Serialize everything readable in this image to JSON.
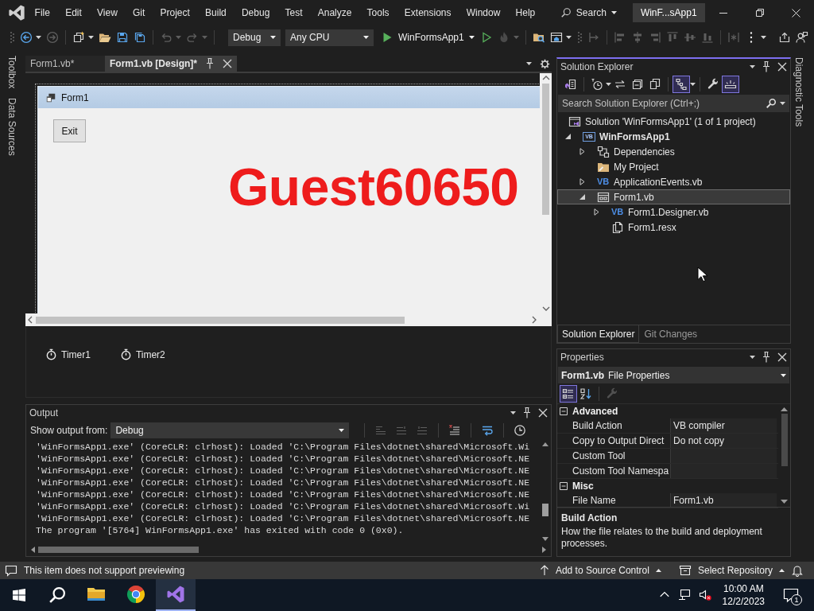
{
  "menu_bar": {
    "items": [
      "File",
      "Edit",
      "View",
      "Git",
      "Project",
      "Build",
      "Debug",
      "Test",
      "Analyze",
      "Tools",
      "Extensions",
      "Window",
      "Help"
    ],
    "search": "Search",
    "solution_name": "WinF...sApp1"
  },
  "toolbar": {
    "left_buttons": [
      {
        "kind": "back",
        "disabled": false,
        "menu": true
      },
      {
        "kind": "forward",
        "disabled": true,
        "menu": false
      },
      {
        "kind": "new-project",
        "disabled": false,
        "menu": true
      },
      {
        "kind": "open",
        "disabled": false,
        "menu": false
      },
      {
        "kind": "save",
        "disabled": false,
        "menu": false
      },
      {
        "kind": "save-all",
        "disabled": false,
        "menu": false
      },
      {
        "kind": "undo",
        "disabled": true,
        "menu": true
      },
      {
        "kind": "redo",
        "disabled": true,
        "menu": true
      }
    ],
    "configuration": "Debug",
    "platform": "Any CPU",
    "start_target": "WinFormsApp1",
    "right_buttons": [
      {
        "kind": "run-outline",
        "disabled": false,
        "menu": false
      },
      {
        "kind": "hot-reload",
        "disabled": true,
        "menu": true
      },
      {
        "kind": "folder-search",
        "disabled": false,
        "menu": false
      },
      {
        "kind": "browser",
        "disabled": false,
        "menu": true
      },
      {
        "kind": "tab-order",
        "disabled": true,
        "menu": false
      },
      {
        "kind": "align-left",
        "disabled": true,
        "menu": false
      },
      {
        "kind": "align-center",
        "disabled": true,
        "menu": false
      },
      {
        "kind": "align-right",
        "disabled": true,
        "menu": false
      },
      {
        "kind": "align-top",
        "disabled": true,
        "menu": false
      },
      {
        "kind": "align-middle",
        "disabled": true,
        "menu": false
      },
      {
        "kind": "align-bottom",
        "disabled": true,
        "menu": false
      },
      {
        "kind": "spacing",
        "disabled": true,
        "menu": false
      },
      {
        "kind": "overflow",
        "disabled": false,
        "menu": true
      }
    ],
    "end_buttons": [
      {
        "kind": "share",
        "disabled": false,
        "menu": false
      },
      {
        "kind": "feedback",
        "disabled": false,
        "menu": false
      }
    ]
  },
  "side_tabs_left": [
    "Toolbox",
    "Data Sources"
  ],
  "editor": {
    "tabs": [
      {
        "label": "Form1.vb*",
        "selected": false
      },
      {
        "label": "Form1.vb [Design]*",
        "selected": true
      }
    ],
    "form": {
      "title": "Form1",
      "button": "Exit",
      "label": "Guest60650"
    },
    "components": [
      "Timer1",
      "Timer2"
    ]
  },
  "output": {
    "title": "Output",
    "source_label": "Show output from:",
    "source": "Debug",
    "buttons": [
      {
        "kind": "goto-source",
        "disabled": true
      },
      {
        "kind": "prev-message",
        "disabled": true
      },
      {
        "kind": "next-message",
        "disabled": true
      },
      {
        "kind": "clear-all",
        "disabled": false
      },
      {
        "kind": "word-wrap",
        "disabled": false
      },
      {
        "kind": "timestamp",
        "disabled": false
      }
    ],
    "lines": [
      "'WinFormsApp1.exe' (CoreCLR: clrhost): Loaded 'C:\\Program Files\\dotnet\\shared\\Microsoft.Wi",
      "'WinFormsApp1.exe' (CoreCLR: clrhost): Loaded 'C:\\Program Files\\dotnet\\shared\\Microsoft.NE",
      "'WinFormsApp1.exe' (CoreCLR: clrhost): Loaded 'C:\\Program Files\\dotnet\\shared\\Microsoft.NE",
      "'WinFormsApp1.exe' (CoreCLR: clrhost): Loaded 'C:\\Program Files\\dotnet\\shared\\Microsoft.NE",
      "'WinFormsApp1.exe' (CoreCLR: clrhost): Loaded 'C:\\Program Files\\dotnet\\shared\\Microsoft.NE",
      "'WinFormsApp1.exe' (CoreCLR: clrhost): Loaded 'C:\\Program Files\\dotnet\\shared\\Microsoft.Wi",
      "'WinFormsApp1.exe' (CoreCLR: clrhost): Loaded 'C:\\Program Files\\dotnet\\shared\\Microsoft.NE",
      "The program '[5764] WinFormsApp1.exe' has exited with code 0 (0x0)."
    ]
  },
  "solution_explorer": {
    "title": "Solution Explorer",
    "buttons": [
      {
        "kind": "switch-views",
        "selected": false,
        "menu": false
      },
      {
        "kind": "history",
        "selected": false,
        "menu": true
      },
      {
        "kind": "sync",
        "selected": false,
        "menu": false
      },
      {
        "kind": "collapse",
        "selected": false,
        "menu": false
      },
      {
        "kind": "show-all",
        "selected": false,
        "menu": false
      },
      {
        "kind": "tree",
        "selected": true,
        "menu": true
      },
      {
        "kind": "properties",
        "selected": false,
        "menu": false
      },
      {
        "kind": "preview",
        "selected": true,
        "menu": false
      }
    ],
    "search": {
      "placeholder": "Search Solution Explorer (Ctrl+;)"
    },
    "tree": [
      {
        "kind": "solution",
        "label": "Solution 'WinFormsApp1' (1 of 1 project)",
        "selected": false,
        "children": [
          {
            "kind": "project",
            "badge": "VB",
            "label": "WinFormsApp1",
            "expanded": true,
            "selected": false,
            "children": [
              {
                "kind": "dependencies",
                "label": "Dependencies",
                "expanded": false,
                "selected": false
              },
              {
                "kind": "my-project",
                "label": "My Project",
                "selected": false
              },
              {
                "kind": "vb-file",
                "badge": "VB",
                "label": "ApplicationEvents.vb",
                "expanded": false,
                "selected": false
              },
              {
                "kind": "form",
                "label": "Form1.vb",
                "expanded": true,
                "selected": true,
                "children": [
                  {
                    "kind": "vb-file",
                    "badge": "VB",
                    "label": "Form1.Designer.vb",
                    "expanded": false,
                    "selected": false
                  },
                  {
                    "kind": "resx",
                    "label": "Form1.resx",
                    "selected": false
                  }
                ]
              }
            ]
          }
        ]
      }
    ],
    "tabs": [
      {
        "label": "Solution Explorer",
        "selected": true
      },
      {
        "label": "Git Changes",
        "selected": false
      }
    ]
  },
  "side_tabs_right": [
    "Diagnostic Tools"
  ],
  "properties": {
    "title": "Properties",
    "object_name": "Form1.vb",
    "object_type": "File Properties",
    "buttons": [
      {
        "kind": "categorized",
        "selected": true,
        "disabled": false
      },
      {
        "kind": "alphabetical",
        "selected": false,
        "disabled": false
      },
      {
        "kind": "property-pages",
        "selected": false,
        "disabled": true
      }
    ],
    "categories": [
      {
        "name": "Advanced",
        "expanded": true,
        "rows": [
          {
            "name": "Build Action",
            "value": "VB compiler"
          },
          {
            "name": "Copy to Output Direct",
            "value": "Do not copy"
          },
          {
            "name": "Custom Tool"
          },
          {
            "name": "Custom Tool Namespa"
          }
        ]
      },
      {
        "name": "Misc",
        "expanded": true,
        "rows": [
          {
            "name": "File Name",
            "value": "Form1.vb"
          }
        ]
      }
    ],
    "description": {
      "title": "Build Action",
      "text": "How the file relates to the build and deployment processes."
    }
  },
  "status_bar": {
    "message": "This item does not support previewing",
    "source_control": "Add to Source Control",
    "repository": "Select Repository"
  },
  "taskbar": {
    "apps": [
      {
        "kind": "folder",
        "active": false
      },
      {
        "kind": "browser",
        "active": false
      },
      {
        "kind": "ide",
        "active": true
      }
    ],
    "time": "10:00 AM",
    "date": "12/2/2023",
    "notifications": "1"
  }
}
